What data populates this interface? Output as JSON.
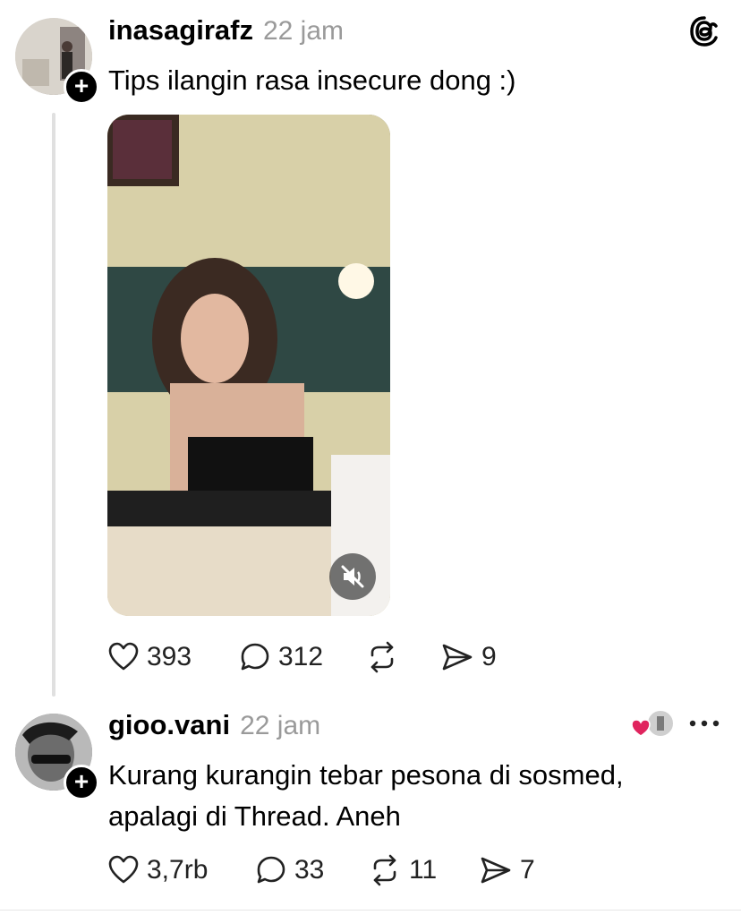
{
  "post": {
    "username": "inasagirafz",
    "time": "22 jam",
    "text": "Tips ilangin rasa insecure dong :)",
    "stats": {
      "likes": "393",
      "replies": "312",
      "shares": "9"
    }
  },
  "reply": {
    "username": "gioo.vani",
    "time": "22 jam",
    "text_line1": "Kurang kurangin tebar pesona di sosmed,",
    "text_line2": "apalagi di Thread. Aneh",
    "stats": {
      "likes": "3,7rb",
      "replies": "33",
      "reposts": "11",
      "shares": "7"
    }
  },
  "icons": {
    "app_logo": "threads-logo-icon",
    "follow": "plus-icon",
    "like": "heart-icon",
    "reply": "comment-icon",
    "repost": "repost-icon",
    "share": "send-icon",
    "mute": "mute-icon",
    "more": "more-icon",
    "liked_by_author": "heart-icon"
  },
  "colors": {
    "accent_heart": "#e0245e",
    "muted_text": "#9a9a9a"
  }
}
